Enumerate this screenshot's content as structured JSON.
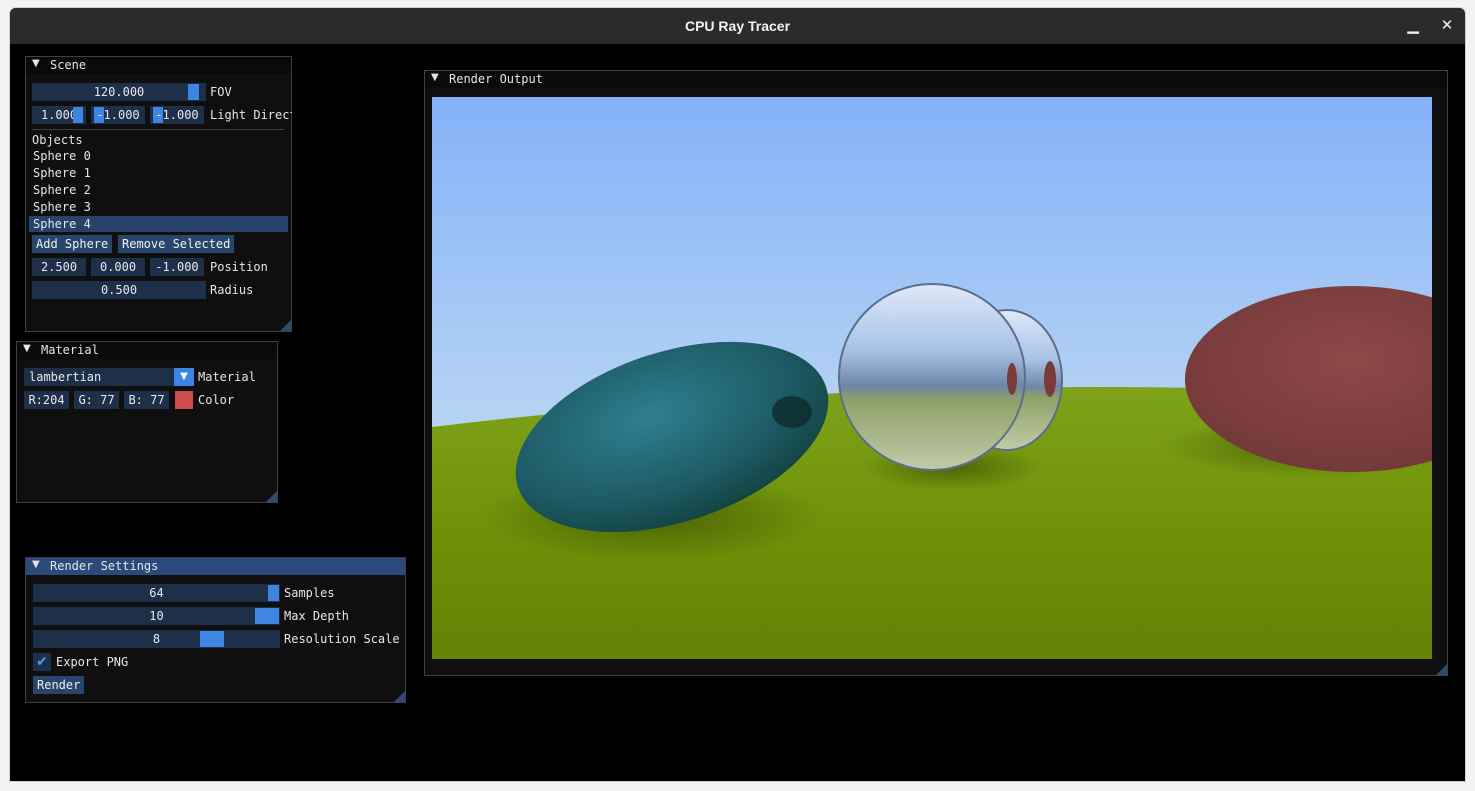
{
  "window": {
    "title": "CPU Ray Tracer",
    "minimize_glyph": "▁",
    "close_glyph": "✕"
  },
  "scene": {
    "title": "Scene",
    "fov": {
      "value": "120.000",
      "label": "FOV",
      "fraction": 0.96
    },
    "light_direction": {
      "x": "1.000",
      "y": "-1.000",
      "z": "-1.000",
      "label": "Light Direction"
    },
    "objects_label": "Objects",
    "objects": [
      "Sphere 0",
      "Sphere 1",
      "Sphere 2",
      "Sphere 3",
      "Sphere 4"
    ],
    "selected_index": 4,
    "add_sphere_label": "Add Sphere",
    "remove_selected_label": "Remove Selected",
    "position": {
      "x": "2.500",
      "y": "0.000",
      "z": "-1.000",
      "label": "Position"
    },
    "radius": {
      "value": "0.500",
      "label": "Radius"
    }
  },
  "material": {
    "title": "Material",
    "type_value": "lambertian",
    "type_label": "Material",
    "color": {
      "r": "R:204",
      "g": "G: 77",
      "b": "B: 77",
      "label": "Color",
      "swatch": "#cc4d4d"
    }
  },
  "render_settings": {
    "title": "Render Settings",
    "samples": {
      "value": "64",
      "label": "Samples",
      "fraction": 1.0
    },
    "max_depth": {
      "value": "10",
      "label": "Max Depth",
      "fraction": 1.0
    },
    "resolution_scale": {
      "value": "8",
      "label": "Resolution Scale",
      "fraction": 0.75
    },
    "export_png": {
      "checked": true,
      "label": "Export PNG",
      "check_glyph": "✔"
    },
    "render_button_label": "Render"
  },
  "render_output": {
    "title": "Render Output"
  },
  "colors": {
    "accent": "#3d85e0",
    "frame_bg": "#1d2f49",
    "button_bg": "#28456c",
    "header_active": "#294a7a",
    "sky_top": "#84b2f8",
    "ground": "#6a8d08"
  },
  "icons": {
    "collapse": "triangle-down-icon",
    "combo": "chevron-down-icon",
    "check": "checkmark-icon"
  }
}
